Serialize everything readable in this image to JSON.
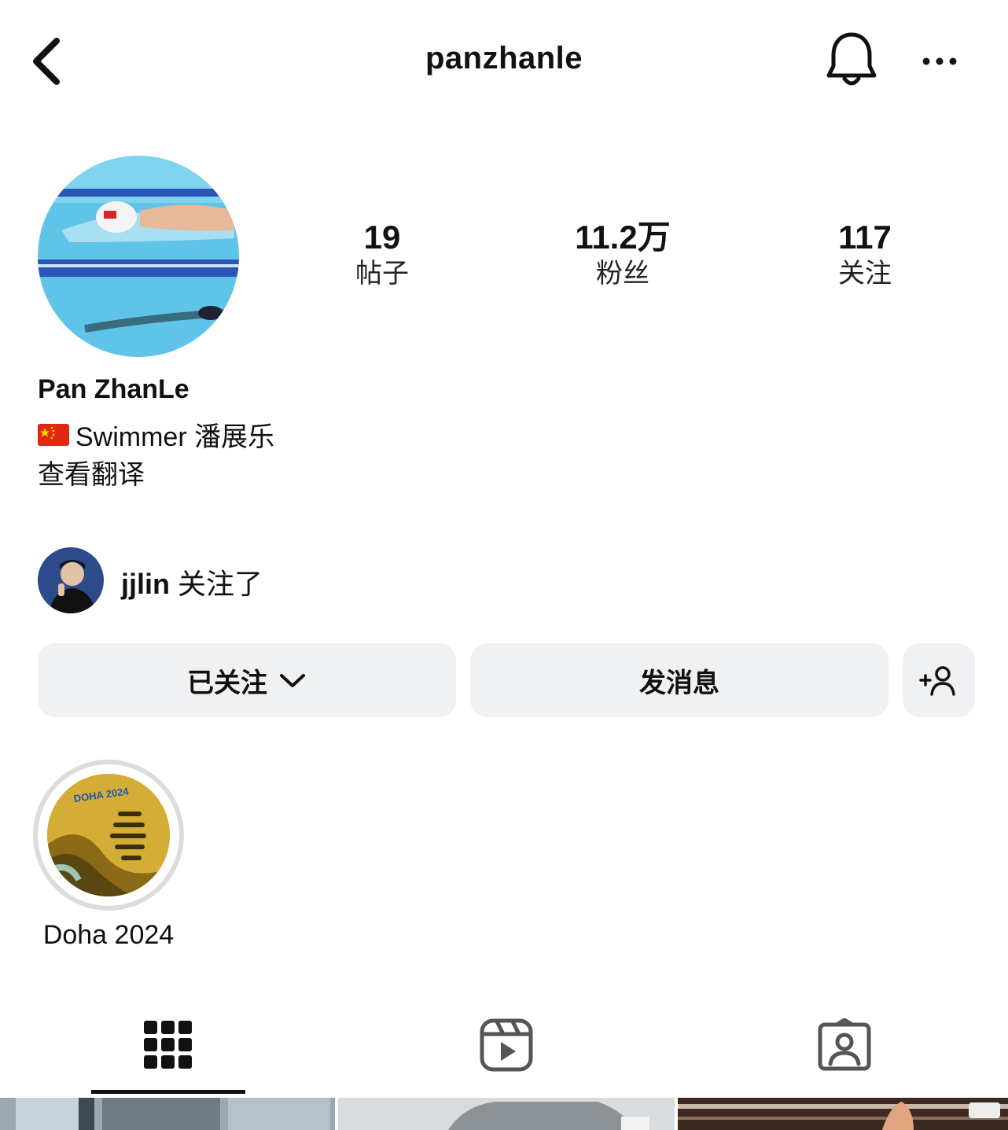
{
  "header": {
    "username": "panzhanle"
  },
  "stats": [
    {
      "value": "19",
      "label": "帖子"
    },
    {
      "value": "11.2万",
      "label": "粉丝"
    },
    {
      "value": "117",
      "label": "关注"
    }
  ],
  "profile": {
    "full_name": "Pan ZhanLe",
    "bio": "Swimmer 潘展乐",
    "translate": "查看翻译"
  },
  "followed_by": {
    "name": "jjlin",
    "suffix": " 关注了"
  },
  "actions": {
    "following": "已关注",
    "message": "发消息"
  },
  "highlights": [
    {
      "label": "Doha 2024"
    }
  ],
  "colors": {
    "button_bg": "#eff1f3",
    "text": "#111111",
    "ring": "#dcdcdc"
  },
  "tabs": [
    {
      "icon": "grid-icon",
      "active": true
    },
    {
      "icon": "reels-icon"
    },
    {
      "icon": "tagged-icon"
    }
  ]
}
